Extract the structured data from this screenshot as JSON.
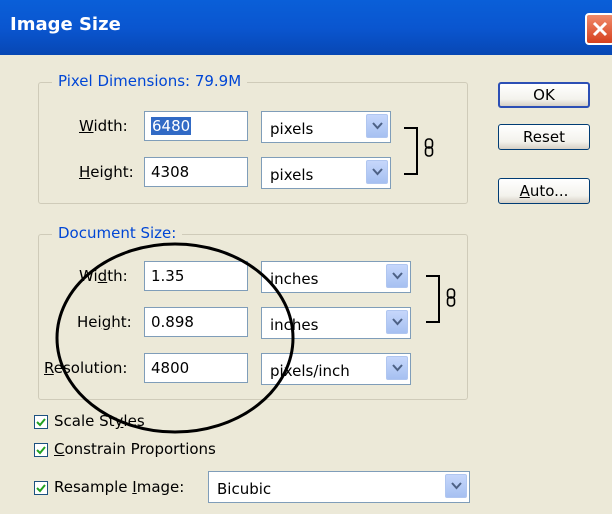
{
  "window": {
    "title": "Image Size"
  },
  "buttons": {
    "ok": "OK",
    "reset": "Reset",
    "auto": "Auto..."
  },
  "pixel_dimensions": {
    "legend": "Pixel Dimensions:  79.9M",
    "width_label_u": "W",
    "width_label_rest": "idth:",
    "width_value": "6480",
    "width_unit": "pixels",
    "height_label_u": "H",
    "height_label_rest": "eight:",
    "height_value": "4308",
    "height_unit": "pixels"
  },
  "document_size": {
    "legend": "Document Size:",
    "width_label_pre": "Wi",
    "width_label_u": "d",
    "width_label_post": "th:",
    "width_value": "1.35",
    "width_unit": "inches",
    "height_label_pre": "Hei",
    "height_label_u": "g",
    "height_label_post": "ht:",
    "height_value": "0.898",
    "height_unit": "inches",
    "res_label_u": "R",
    "res_label_rest": "esolution:",
    "res_value": "4800",
    "res_unit": "pixels/inch"
  },
  "options": {
    "scale_styles_pre": "Scale St",
    "scale_styles_u": "y",
    "scale_styles_post": "les",
    "scale_styles_checked": true,
    "constrain_u": "C",
    "constrain_rest": "onstrain Proportions",
    "constrain_checked": true,
    "resample_pre": "Resample ",
    "resample_u": "I",
    "resample_post": "mage:",
    "resample_checked": true,
    "resample_method": "Bicubic"
  },
  "colors": {
    "title_bar": "#0a56d0",
    "legend_text": "#0046d5",
    "dialog_bg": "#ece9d8"
  }
}
